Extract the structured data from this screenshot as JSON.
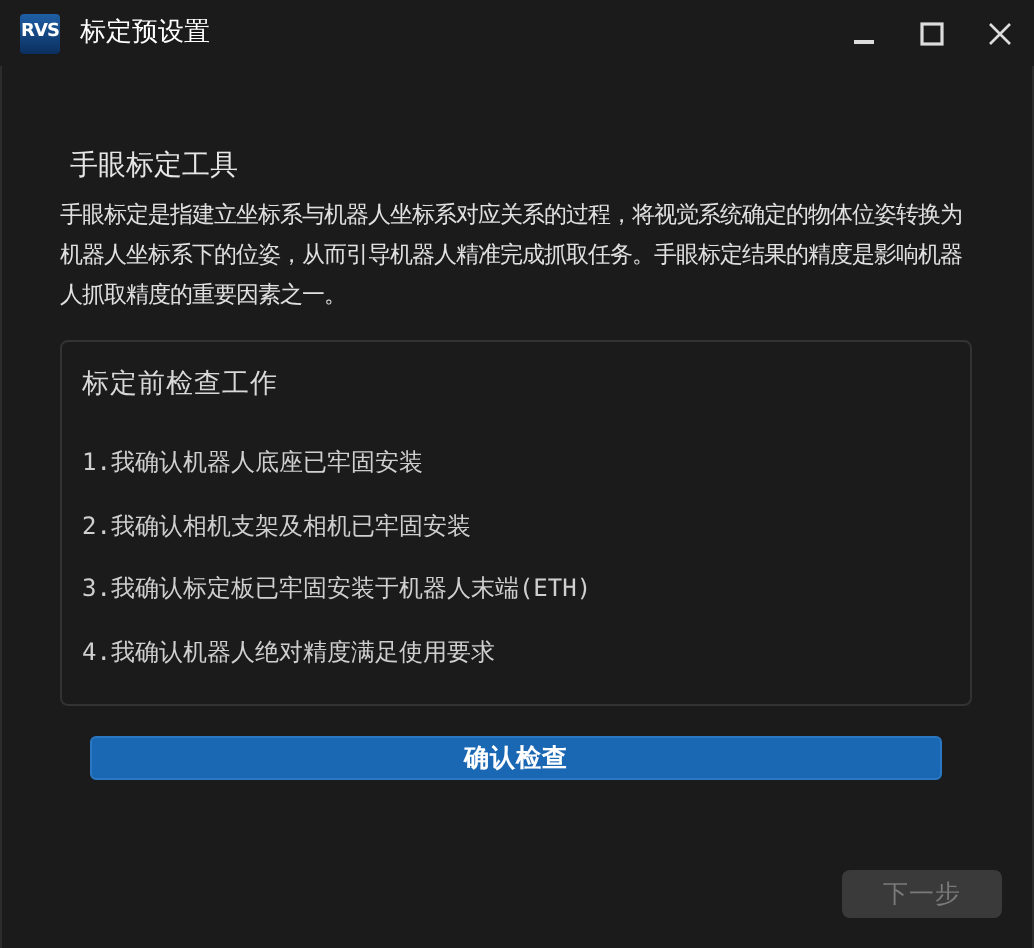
{
  "window": {
    "title": "标定预设置",
    "logo": "RVS"
  },
  "heading": "手眼标定工具",
  "description": "手眼标定是指建立坐标系与机器人坐标系对应关系的过程，将视觉系统确定的物体位姿转换为机器人坐标系下的位姿，从而引导机器人精准完成抓取任务。手眼标定结果的精度是影响机器人抓取精度的重要因素之一。",
  "checklist": {
    "title": "标定前检查工作",
    "items": [
      "1.我确认机器人底座已牢固安装",
      "2.我确认相机支架及相机已牢固安装",
      "3.我确认标定板已牢固安装于机器人末端(ETH)",
      "4.我确认机器人绝对精度满足使用要求"
    ]
  },
  "confirm_button": {
    "label": "确认检查",
    "disabled": false
  },
  "next_button": {
    "label": "下一步",
    "disabled": true
  }
}
